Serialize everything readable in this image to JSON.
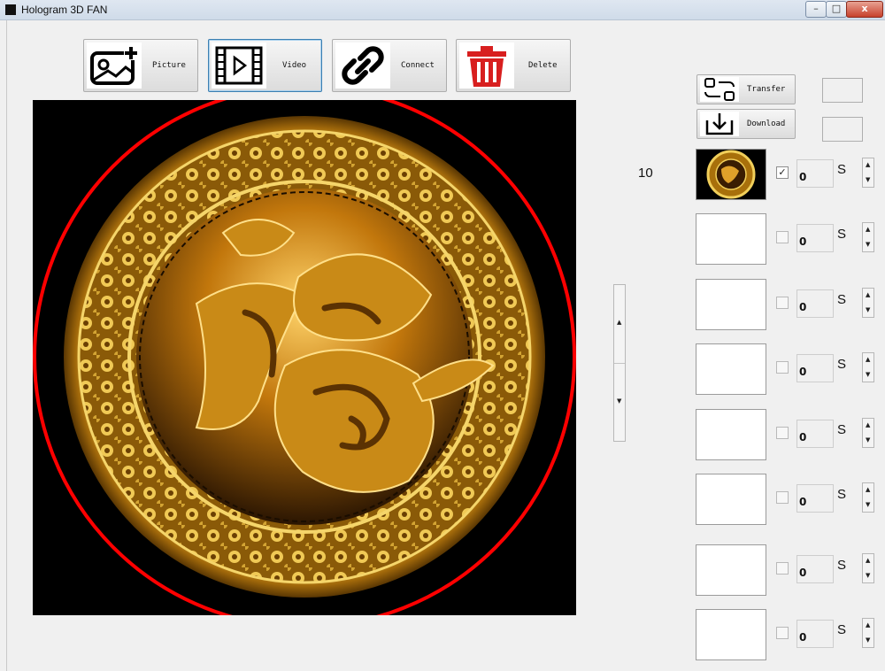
{
  "window": {
    "title": "Hologram 3D FAN",
    "min_label": "–",
    "max_label": "□",
    "close_label": "x"
  },
  "toolbar": {
    "picture_label": "Picture",
    "video_label": "Video",
    "connect_label": "Connect",
    "delete_label": "Delete"
  },
  "side": {
    "transfer_label": "Transfer",
    "download_label": "Download",
    "count": "10"
  },
  "playlist": [
    {
      "seconds": "0",
      "unit": "S",
      "checked": true,
      "has_thumb": true
    },
    {
      "seconds": "0",
      "unit": "S",
      "checked": false,
      "has_thumb": false
    },
    {
      "seconds": "0",
      "unit": "S",
      "checked": false,
      "has_thumb": false
    },
    {
      "seconds": "0",
      "unit": "S",
      "checked": false,
      "has_thumb": false
    },
    {
      "seconds": "0",
      "unit": "S",
      "checked": false,
      "has_thumb": false
    },
    {
      "seconds": "0",
      "unit": "S",
      "checked": false,
      "has_thumb": false
    },
    {
      "seconds": "0",
      "unit": "S",
      "checked": false,
      "has_thumb": false
    },
    {
      "seconds": "0",
      "unit": "S",
      "checked": false,
      "has_thumb": false
    }
  ],
  "colors": {
    "ring": "#ff0000",
    "gold": "#d9a21c",
    "delete_red": "#d81f1f"
  },
  "icons": [
    "picture-icon",
    "video-icon",
    "connect-icon",
    "delete-icon",
    "transfer-icon",
    "download-icon"
  ]
}
